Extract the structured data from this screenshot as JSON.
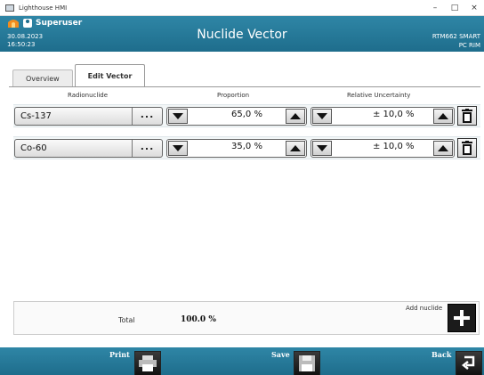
{
  "window": {
    "app_title": "Lighthouse HMI",
    "minimize": "–",
    "maximize": "□",
    "close": "×"
  },
  "header": {
    "user": "Superuser",
    "date": "30.08.2023",
    "time": "16:50:23",
    "title": "Nuclide Vector",
    "device_line1": "RTM662 SMART",
    "device_line2": "PC RIM"
  },
  "tabs": [
    {
      "label": "Overview",
      "active": false
    },
    {
      "label": "Edit Vector",
      "active": true
    }
  ],
  "columns": {
    "radionuclide": "Radionuclide",
    "proportion": "Proportion",
    "uncertainty": "Relative Uncertainty"
  },
  "rows": [
    {
      "nuclide": "Cs-137",
      "dots": "...",
      "proportion": "65,0 %",
      "uncertainty": "± 10,0 %"
    },
    {
      "nuclide": "Co-60",
      "dots": "...",
      "proportion": "35,0 %",
      "uncertainty": "± 10,0 %"
    }
  ],
  "total": {
    "label": "Total",
    "value": "100.0 %",
    "add_label": "Add nuclide"
  },
  "footer": {
    "print": "Print",
    "save": "Save",
    "back": "Back"
  },
  "colors": {
    "header_bg": "#1e6d8c",
    "footer_bg": "#1e6d8c",
    "button_dark": "#1b1b1b"
  }
}
